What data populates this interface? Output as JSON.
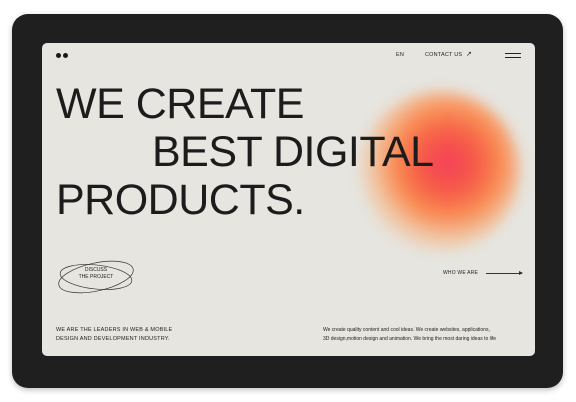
{
  "nav": {
    "language": "EN",
    "contact": "CONTACT US",
    "contact_arrow": "↗"
  },
  "hero": {
    "line1": "WE CREATE",
    "line2": "BEST DIGITAL",
    "line3": "PRODUCTS."
  },
  "cta": {
    "line1": "DISCUSS",
    "line2": "THE PROJECT"
  },
  "who_we_are": "WHO WE ARE",
  "footer": {
    "leaders_line1": "WE ARE THE LEADERS IN WEB & MOBILE",
    "leaders_line2": "DESIGN  AND DEVELOPMENT INDUSTRY.",
    "desc_line1": "We create quality content and cool ideas. We create websites, applications,",
    "desc_line2": "3D design,motion design and animation. We bring the most daring ideas to life"
  },
  "colors": {
    "frame": "#1f1f1f",
    "screen": "#e6e5df",
    "text": "#1c1c1c",
    "glow_core": "#f4405a",
    "glow_outer": "#f98a52"
  },
  "icons": [
    "logo-dots-icon",
    "arrow-up-right-icon",
    "menu-icon",
    "arrow-right-icon"
  ]
}
